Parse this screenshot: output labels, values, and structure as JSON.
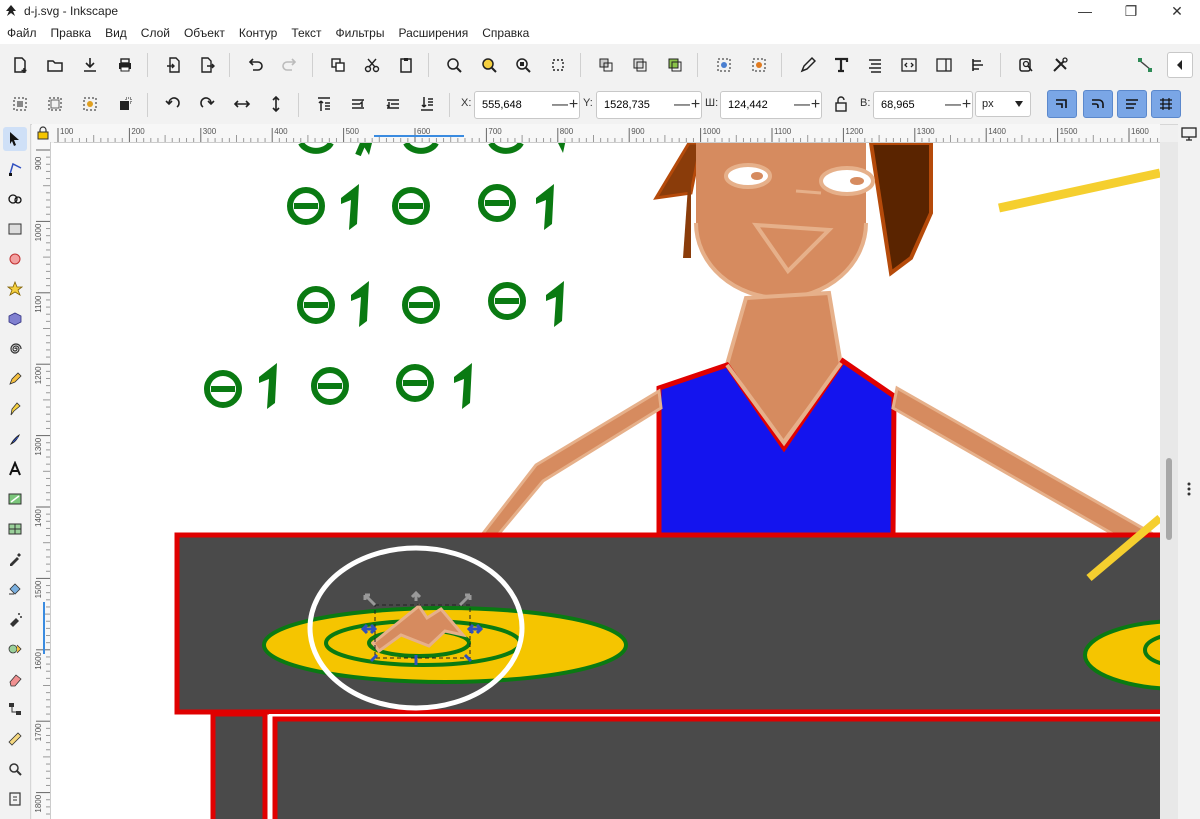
{
  "window": {
    "title": "d-j.svg - Inkscape",
    "controls": {
      "minimize": "—",
      "restore": "❐",
      "close": "✕"
    }
  },
  "menu": [
    "Файл",
    "Правка",
    "Вид",
    "Слой",
    "Объект",
    "Контур",
    "Текст",
    "Фильтры",
    "Расширения",
    "Справка"
  ],
  "toolbar": {
    "x_label": "X:",
    "x_value": "555,648",
    "y_label": "Y:",
    "y_value": "1528,735",
    "w_label": "Ш:",
    "w_value": "124,442",
    "h_label": "В:",
    "h_value": "68,965",
    "unit": "px",
    "minus": "—",
    "plus": "+"
  },
  "rulers": {
    "horizontal": [
      "100",
      "200",
      "300",
      "400",
      "500",
      "600",
      "700",
      "800",
      "900",
      "1000",
      "1100",
      "1200",
      "1300",
      "1400",
      "1500",
      "1600"
    ],
    "vertical": [
      "900",
      "1000",
      "1100",
      "1200",
      "1300",
      "1400",
      "1500",
      "1600",
      "1700",
      "1800"
    ]
  },
  "colors": {
    "green": "#0a7a12",
    "skin": "#d68b5f",
    "skin_light": "#e6b08a",
    "hair": "#8a3c0a",
    "shirt": "#1414ee",
    "red": "#e00000",
    "table": "#4a4a4a",
    "record": "#f5c500",
    "stick": "#f5cf2f",
    "accent": "#7aa6e6"
  }
}
